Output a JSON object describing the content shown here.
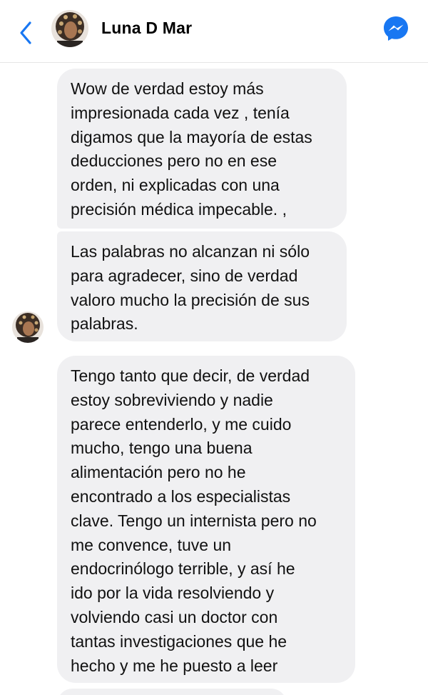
{
  "header": {
    "contact_name": "Luna D Mar",
    "back_icon": "chevron-left-icon",
    "messenger_icon": "messenger-icon",
    "accent_color": "#1877F2"
  },
  "messages": [
    {
      "sender": "contact",
      "text": "Wow de verdad estoy más\nimpresionada cada vez , tenía\ndigamos que la mayoría de estas\ndeducciones pero no en ese\norden, ni explicadas con una\nprecisión médica impecable. ,"
    },
    {
      "sender": "contact",
      "text": "Las palabras no alcanzan ni sólo\npara agradecer, sino de verdad\nvaloro mucho la precisión de sus\npalabras."
    },
    {
      "sender": "contact",
      "text": "Tengo tanto que decir, de verdad\nestoy sobreviviendo y nadie\nparece entenderlo, y me cuido\nmucho, tengo una buena\nalimentación pero no he\nencontrado a los especialistas\nclave. Tengo un internista pero no\nme convence, tuve un\nendocrinólogo terrible, y así he\nido por la vida resolviendo y\nvolviendo casi un doctor con\ntantas investigaciones que he\nhecho y me he puesto a leer"
    }
  ],
  "colors": {
    "bubble_background": "#F0F0F2",
    "text": "#111111"
  }
}
